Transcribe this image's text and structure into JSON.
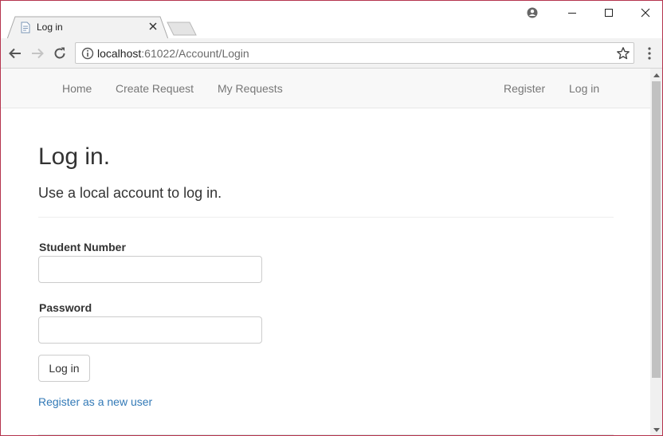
{
  "browser": {
    "tab_title": "Log in",
    "url_host": "localhost",
    "url_path": ":61022/Account/Login"
  },
  "navbar": {
    "left_links": [
      "Home",
      "Create Request",
      "My Requests"
    ],
    "right_links": [
      "Register",
      "Log in"
    ]
  },
  "page": {
    "title": "Log in.",
    "subtitle": "Use a local account to log in.",
    "student_number_label": "Student Number",
    "student_number_value": "",
    "password_label": "Password",
    "password_value": "",
    "submit_label": "Log in",
    "register_link": "Register as a new user"
  },
  "colors": {
    "link": "#337ab7",
    "nav_text": "#777777",
    "window_border": "#b5344e"
  }
}
